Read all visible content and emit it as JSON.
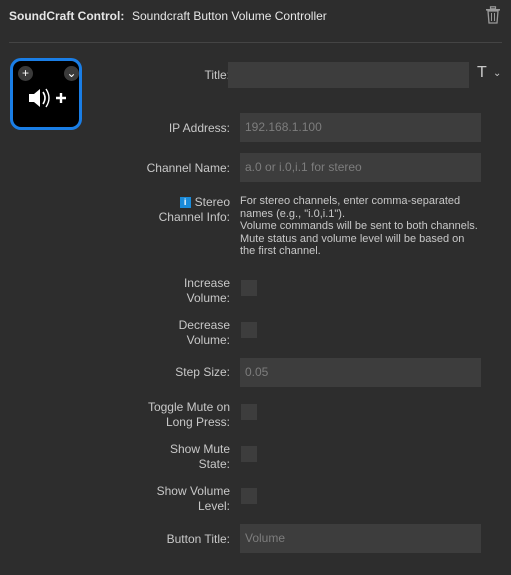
{
  "header": {
    "plugin_name": "SoundCraft Control:",
    "action_name": "Soundcraft Button Volume Controller"
  },
  "preview": {
    "plus_symbol": "+",
    "chevron_symbol": "⌄",
    "icon": "speaker-volume-up-icon",
    "border_color": "#1a7ee6"
  },
  "title_field": {
    "label": "Title:",
    "value": "",
    "t_symbol": "T",
    "chevron_symbol": "⌄"
  },
  "ip_address": {
    "label": "IP Address:",
    "placeholder": "192.168.1.100"
  },
  "channel_name": {
    "label": "Channel Name:",
    "placeholder": "a.0 or i.0,i.1 for stereo"
  },
  "stereo_info": {
    "badge": "i",
    "label_line1": "Stereo",
    "label_line2": "Channel Info:",
    "lines": [
      "For stereo channels, enter comma-separated",
      "names (e.g., \"i.0,i.1\").",
      "Volume commands will be sent to both channels.",
      "Mute status and volume level will be based on",
      "the first channel."
    ]
  },
  "increase_volume": {
    "label_line1": "Increase",
    "label_line2": "Volume:"
  },
  "decrease_volume": {
    "label_line1": "Decrease",
    "label_line2": "Volume:"
  },
  "step_size": {
    "label": "Step Size:",
    "placeholder": "0.05"
  },
  "toggle_mute": {
    "label_line1": "Toggle Mute on",
    "label_line2": "Long Press:"
  },
  "show_mute_state": {
    "label_line1": "Show Mute",
    "label_line2": "State:"
  },
  "show_volume_level": {
    "label_line1": "Show Volume",
    "label_line2": "Level:"
  },
  "button_title": {
    "label": "Button Title:",
    "placeholder": "Volume"
  }
}
